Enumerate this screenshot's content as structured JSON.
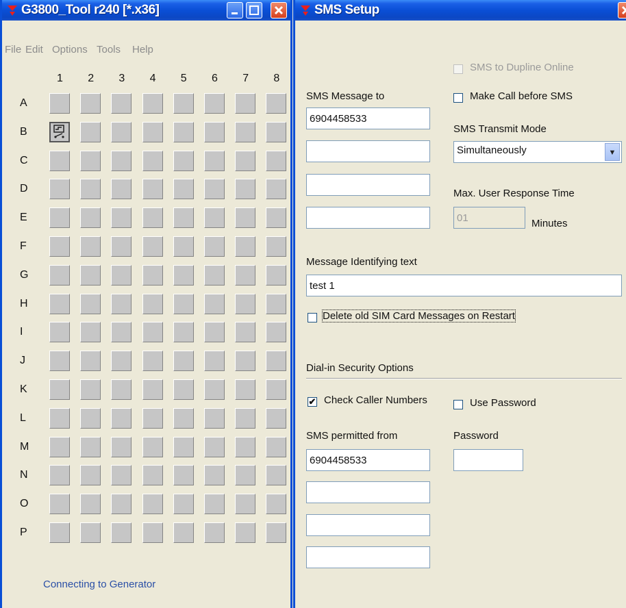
{
  "left_window": {
    "title": "G3800_Tool r240 [*.x36]",
    "menu": [
      "File",
      "Edit",
      "Options",
      "Tools",
      "Help"
    ],
    "columns": [
      "1",
      "2",
      "3",
      "4",
      "5",
      "6",
      "7",
      "8"
    ],
    "rows": [
      "A",
      "B",
      "C",
      "D",
      "E",
      "F",
      "G",
      "H",
      "I",
      "J",
      "K",
      "L",
      "M",
      "N",
      "O",
      "P"
    ],
    "active_cell": {
      "row": "B",
      "column": "1",
      "icon": "switch-icon"
    },
    "status": "Connecting to Generator"
  },
  "sms_dialog": {
    "title": "SMS Setup",
    "sms_message_to_label": "SMS Message to",
    "sms_message_to": [
      "6904458533",
      "",
      "",
      ""
    ],
    "sms_to_dupline_online": {
      "label": "SMS to Dupline Online",
      "checked": false,
      "enabled": false
    },
    "make_call_before_sms": {
      "label": "Make Call before SMS",
      "checked": false
    },
    "transmit_mode_label": "SMS Transmit Mode",
    "transmit_mode_value": "Simultaneously",
    "max_response_label": "Max. User Response Time",
    "max_response_value": "01",
    "max_response_unit": "Minutes",
    "identifying_text_label": "Message Identifying text",
    "identifying_text_value": "test 1",
    "delete_old_sim": {
      "label": "Delete old SIM Card Messages on Restart",
      "checked": false
    },
    "security_header": "Dial-in Security Options",
    "check_caller_numbers": {
      "label": "Check Caller Numbers",
      "checked": true
    },
    "use_password": {
      "label": "Use Password",
      "checked": false
    },
    "permitted_from_label": "SMS permitted from",
    "permitted_from": [
      "6904458533",
      "",
      "",
      ""
    ],
    "password_label": "Password",
    "password_value": ""
  },
  "colors": {
    "titlebar": "#0a4fd6",
    "window_bg": "#ece9d8",
    "status_text": "#2a4fa6"
  }
}
